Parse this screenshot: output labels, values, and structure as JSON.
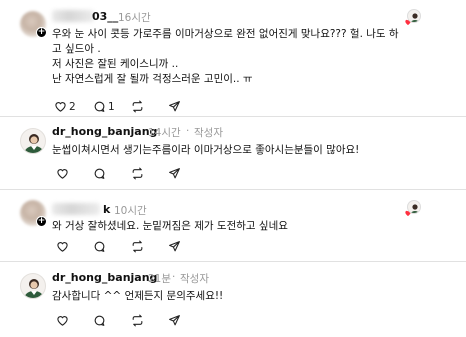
{
  "comments": [
    {
      "user": "03__",
      "time": "16시간",
      "lines": [
        "우와 눈 사이 콧등 가로주름 이마거상으로 완전 없어진게 맞나요??? 헐. 나도 하",
        "고 싶드아 .",
        "저 사진은 잘된 케이스니까 ..",
        "난 자연스럽게 잘 될까 걱정스러운 고민이.. ㅠ"
      ],
      "like_count": "2",
      "reply_count": "1"
    },
    {
      "user": "dr_hong_banjang",
      "time": "14시간",
      "author_tag": "작성자",
      "text": "눈썹이쳐시면서 생기는주름이라 이마거상으로 좋아시는분들이 많아요!"
    },
    {
      "user": "k",
      "time": "10시간",
      "text": "와 거상 잘하셨네요. 눈밑꺼짐은 제가 도전하고 싶네요"
    },
    {
      "user": "dr_hong_banjang",
      "time": "21분",
      "author_tag": "작성자",
      "text": "감사합니다 ^^ 언제든지 문의주세요!!"
    }
  ],
  "icons": [
    "heart-icon",
    "comment-icon",
    "repost-icon",
    "share-icon",
    "plus-icon",
    "liked-heart-icon"
  ],
  "colors": {
    "liked_red": "#ff3040",
    "meta_gray": "#999999",
    "divider": "#e1e1e1"
  }
}
